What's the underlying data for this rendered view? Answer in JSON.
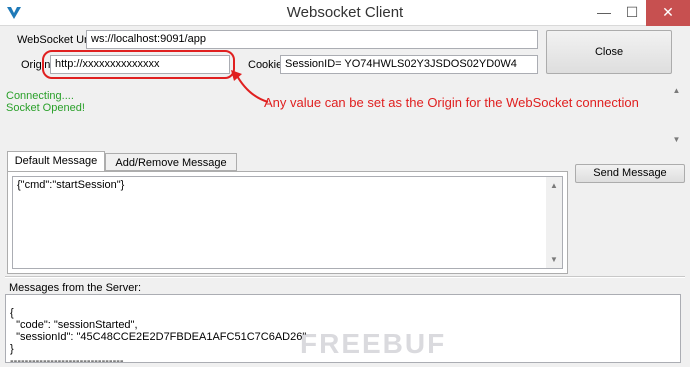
{
  "window": {
    "title": "Websocket Client",
    "minimize_glyph": "—",
    "maximize_glyph": "☐",
    "close_glyph": "✕"
  },
  "connection": {
    "url_label": "WebSocket Url",
    "url_value": "ws://localhost:9091/app",
    "origin_label": "Origin",
    "origin_value": "http://xxxxxxxxxxxxxx",
    "cookie_label": "Cookie",
    "cookie_value": "SessionID= YO74HWLS02Y3JSDOS02YD0W4",
    "close_button": "Close"
  },
  "status": {
    "lines": [
      "Connecting....",
      "Socket Opened!"
    ],
    "color": "#2aa02a"
  },
  "annotation": {
    "text": "Any value can be set as the Origin for the WebSocket connection",
    "color": "#e02020"
  },
  "tabs": [
    {
      "label": "Default Message",
      "active": true
    },
    {
      "label": "Add/Remove Message Tabs",
      "active": false
    }
  ],
  "message": {
    "body": "{\"cmd\":\"startSession\"}",
    "send_button": "Send Message"
  },
  "server": {
    "label": "Messages from the Server:",
    "body": "{\n  \"code\": \"sessionStarted\",\n  \"sessionId\": \"45C48CCE2E2D7FBDEA1AFC51C7C6AD26\"\n}\n-------------------------------"
  },
  "watermark": "FREEBUF",
  "icons": {
    "app": "app-logo-icon",
    "arrow": "red-arrow-annotation"
  }
}
